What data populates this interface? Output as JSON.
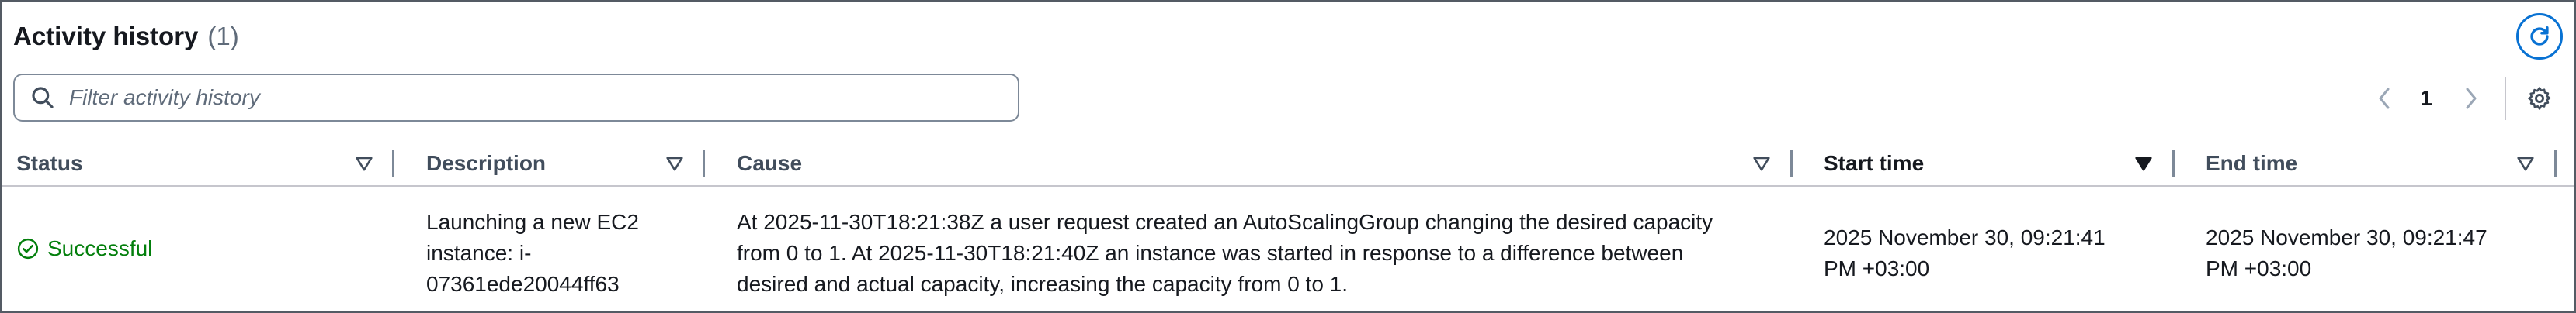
{
  "header": {
    "title": "Activity history",
    "count": "(1)"
  },
  "filter": {
    "placeholder": "Filter activity history",
    "value": ""
  },
  "pagination": {
    "current_page": "1"
  },
  "table": {
    "columns": [
      {
        "label": "Status"
      },
      {
        "label": "Description"
      },
      {
        "label": "Cause"
      },
      {
        "label": "Start time"
      },
      {
        "label": "End time"
      }
    ],
    "rows": [
      {
        "status": "Successful",
        "description": "Launching a new EC2 instance: i-07361ede20044ff63",
        "cause": "At 2025-11-30T18:21:38Z a user request created an AutoScalingGroup changing the desired capacity from 0 to 1. At 2025-11-30T18:21:40Z an instance was started in response to a difference between desired and actual capacity, increasing the capacity from 0 to 1.",
        "start_time": "2025 November 30, 09:21:41 PM +03:00",
        "end_time": "2025 November 30, 09:21:47 PM +03:00"
      }
    ]
  },
  "colors": {
    "primary": "#0972d3",
    "success": "#037f0c",
    "text": "#16191f",
    "muted": "#5f6b7a",
    "border": "#545b64"
  },
  "icons": {
    "refresh": "refresh-icon",
    "search": "search-icon",
    "prev": "chevron-left-icon",
    "next": "chevron-right-icon",
    "settings": "gear-icon",
    "sort": "sort-caret-icon",
    "status": "check-circle-icon"
  }
}
